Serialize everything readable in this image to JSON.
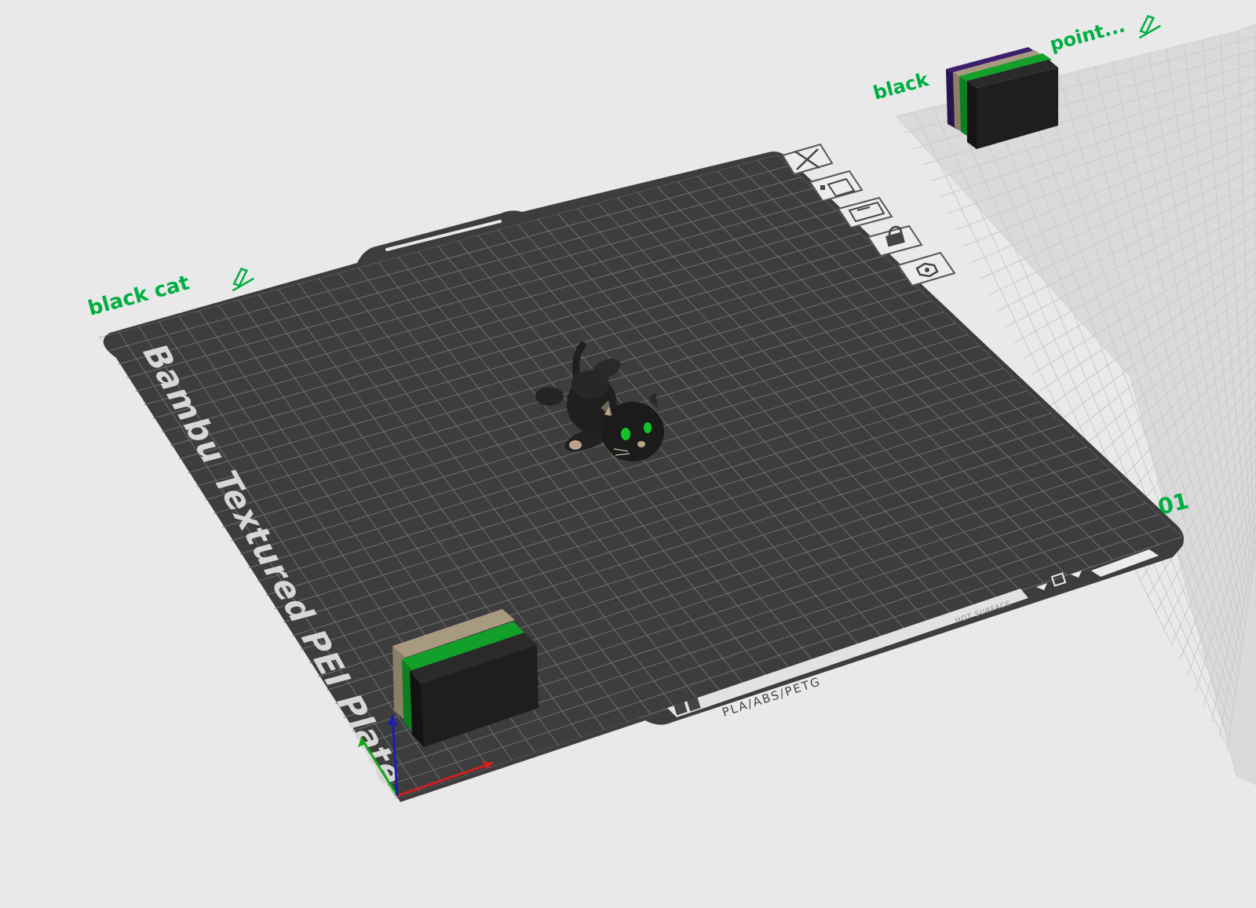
{
  "colors": {
    "background": "#e9e9e9",
    "plate_surface": "#454545",
    "plate_frame": "#3a3a3a",
    "grid_line": "#707070",
    "accent_green": "#00ae42",
    "secondary_plate": "#dadada"
  },
  "plates": [
    {
      "name_label": "black cat",
      "plate_type": "Bambu Textured PEI Plate",
      "plate_number": "01",
      "material_label": "PLA/ABS/PETG",
      "warning_label": "HOT SURFACE",
      "tools": [
        {
          "name": "close-icon"
        },
        {
          "name": "auto-arrange-icon"
        },
        {
          "name": "plate-layout-icon"
        },
        {
          "name": "lock-icon"
        },
        {
          "name": "settings-icon"
        }
      ]
    },
    {
      "name_label_start": "black",
      "name_label_end": "point...",
      "plate_type": ""
    }
  ],
  "objects": [
    {
      "name": "cat-model",
      "color": "#1d1d1d"
    },
    {
      "name": "wipe-tower-1",
      "colors": [
        "#a89a80",
        "#13a02a",
        "#1d1d1d"
      ]
    },
    {
      "name": "wipe-tower-2",
      "colors": [
        "#3d1d6e",
        "#a89a80",
        "#13a02a",
        "#1d1d1d"
      ]
    }
  ],
  "axes": {
    "x_color": "#d21f1f",
    "y_color": "#12a818",
    "z_color": "#1c1cb8"
  }
}
